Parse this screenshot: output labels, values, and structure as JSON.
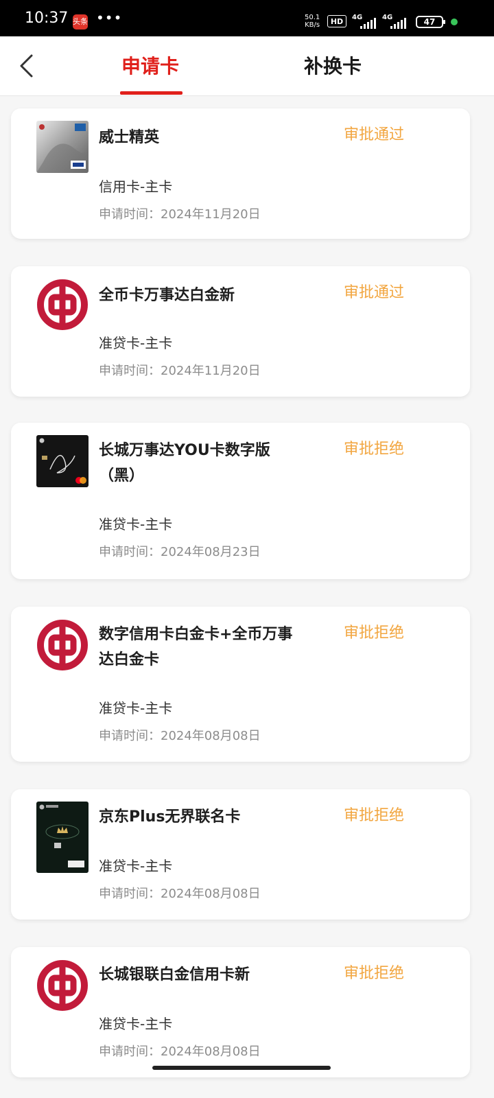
{
  "status_bar": {
    "time": "10:37",
    "app_badge": "头条",
    "dots": "•••",
    "speed_top": "50.1",
    "speed_bottom": "KB/s",
    "hd": "HD",
    "net1": "4G",
    "net2": "4G",
    "battery": "47"
  },
  "header": {
    "tab_apply": "申请卡",
    "tab_replace": "补换卡"
  },
  "items": [
    {
      "name": "威士精英",
      "type": "信用卡-主卡",
      "time": "申请时间：2024年11月20日",
      "status": "审批通过",
      "icon": "visa-platinum-card"
    },
    {
      "name": "全币卡万事达白金新",
      "type": "准贷卡-主卡",
      "time": "申请时间：2024年11月20日",
      "status": "审批通过",
      "icon": "boc-logo"
    },
    {
      "name": "长城万事达YOU卡数字版（黑）",
      "type": "准贷卡-主卡",
      "time": "申请时间：2024年08月23日",
      "status": "审批拒绝",
      "icon": "mastercard-black-card"
    },
    {
      "name": "数字信用卡白金卡+全币万事达白金卡",
      "type": "准贷卡-主卡",
      "time": "申请时间：2024年08月08日",
      "status": "审批拒绝",
      "icon": "boc-logo"
    },
    {
      "name": "京东Plus无界联名卡",
      "type": "准贷卡-主卡",
      "time": "申请时间：2024年08月08日",
      "status": "审批拒绝",
      "icon": "jd-plus-card"
    },
    {
      "name": "长城银联白金信用卡新",
      "type": "准贷卡-主卡",
      "time": "申请时间：2024年08月08日",
      "status": "审批拒绝",
      "icon": "boc-logo"
    }
  ],
  "colors": {
    "accent": "#e0201b",
    "status": "#f2a640",
    "boc_red": "#c21b3a"
  }
}
